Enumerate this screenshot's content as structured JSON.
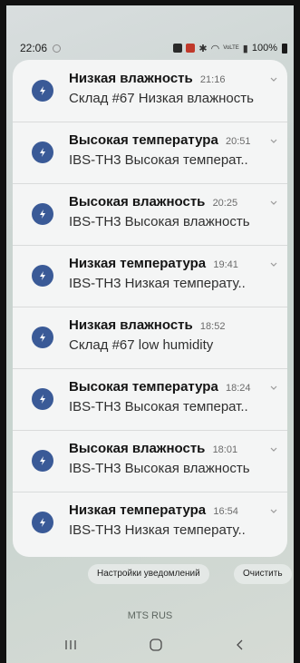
{
  "status_bar": {
    "time": "22:06",
    "network_label": "VoLTE",
    "battery": "100%"
  },
  "notifications": [
    {
      "title": "Низкая влажность",
      "time": "21:16",
      "body": "Склад #67 Низкая влажность"
    },
    {
      "title": "Высокая температура",
      "time": "20:51",
      "body": "IBS-TH3 Высокая температ.."
    },
    {
      "title": "Высокая влажность",
      "time": "20:25",
      "body": "IBS-TH3 Высокая влажность"
    },
    {
      "title": "Низкая температура",
      "time": "19:41",
      "body": "IBS-TH3 Низкая температу.."
    },
    {
      "title": "Низкая влажность",
      "time": "18:52",
      "body": "Склад #67 low humidity"
    },
    {
      "title": "Высокая температура",
      "time": "18:24",
      "body": "IBS-TH3 Высокая температ.."
    },
    {
      "title": "Высокая влажность",
      "time": "18:01",
      "body": "IBS-TH3 Высокая влажность"
    },
    {
      "title": "Низкая температура",
      "time": "16:54",
      "body": "IBS-TH3 Низкая температу.."
    }
  ],
  "actions": {
    "settings_label": "Настройки уведомлений",
    "clear_label": "Очистить"
  },
  "carrier": "MTS RUS",
  "icons": {
    "app": "app-bolt-icon",
    "expand": "chevron-down-icon",
    "nav_recent": "recent-apps-icon",
    "nav_home": "home-icon",
    "nav_back": "back-icon"
  },
  "colors": {
    "app_icon": "#3a5a97",
    "panel": "#f4f5f5"
  }
}
